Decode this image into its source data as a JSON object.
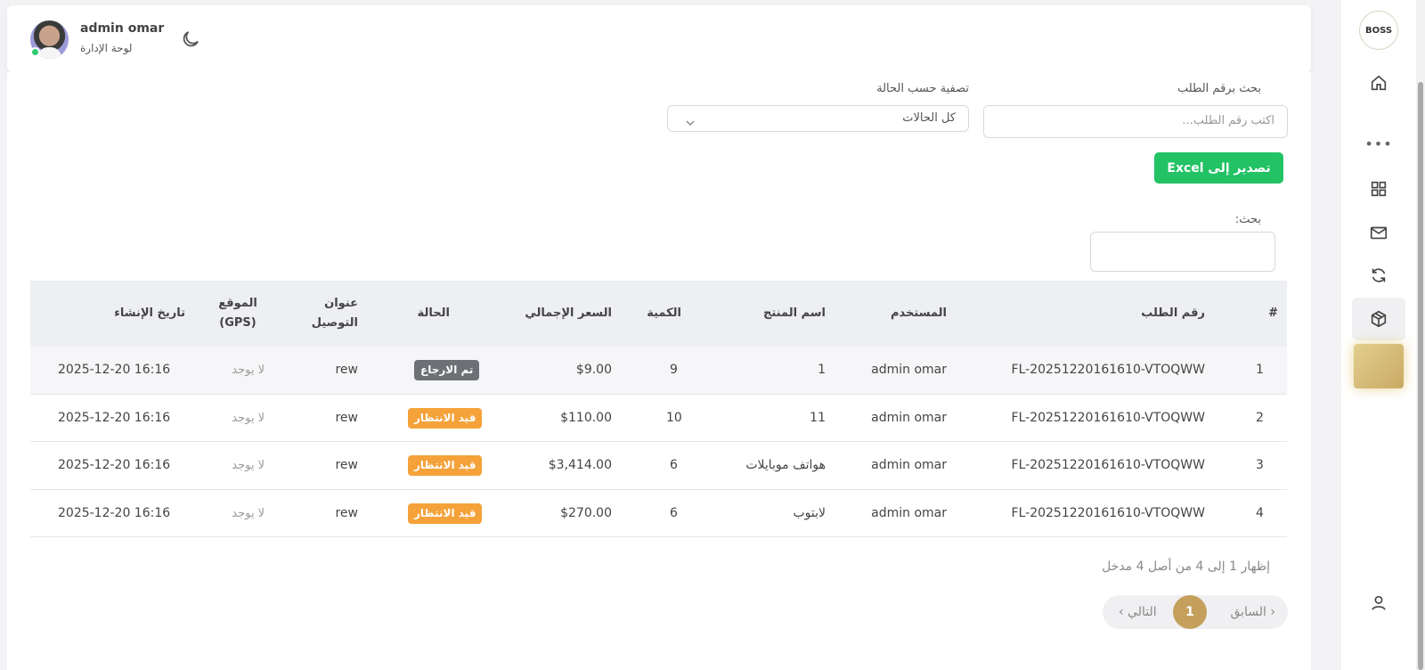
{
  "topbar": {
    "user_name": "admin omar",
    "user_role": "لوحة الإدارة"
  },
  "sidebar": {
    "logo_text": "BOSS",
    "items": [
      "home-icon",
      "more-icon",
      "grid-icon",
      "mail-icon",
      "refresh-icon",
      "box-icon"
    ]
  },
  "filters": {
    "search_label": "بحث برقم الطلب",
    "search_placeholder": "اكتب رقم الطلب...",
    "status_label": "تصفية حسب الحالة",
    "status_selected": "كل الحالات"
  },
  "export_label": "تصدير إلى Excel",
  "table_search_label": "بحث:",
  "table": {
    "headers": [
      "#",
      "رقم الطلب",
      "المستخدم",
      "اسم المنتج",
      "الكمية",
      "السعر الإجمالي",
      "الحالة",
      "عنوان التوصيل",
      "الموقع (GPS)",
      "تاريخ الإنشاء"
    ],
    "rows": [
      {
        "n": "1",
        "order": "FL-20251220161610-VTOQWW",
        "user": "admin omar",
        "product": "1",
        "qty": "9",
        "price": "$9.00",
        "status": "تم الارجاع",
        "status_color": "#6d7075",
        "address": "rew",
        "gps": "لا يوجد",
        "date": "2025-12-20 16:16"
      },
      {
        "n": "2",
        "order": "FL-20251220161610-VTOQWW",
        "user": "admin omar",
        "product": "11",
        "qty": "10",
        "price": "$110.00",
        "status": "قيد الانتظار",
        "status_color": "#f5a23a",
        "address": "rew",
        "gps": "لا يوجد",
        "date": "2025-12-20 16:16"
      },
      {
        "n": "3",
        "order": "FL-20251220161610-VTOQWW",
        "user": "admin omar",
        "product": "هواتف موبايلات",
        "qty": "6",
        "price": "$3,414.00",
        "status": "قيد الانتظار",
        "status_color": "#f5a23a",
        "address": "rew",
        "gps": "لا يوجد",
        "date": "2025-12-20 16:16"
      },
      {
        "n": "4",
        "order": "FL-20251220161610-VTOQWW",
        "user": "admin omar",
        "product": "لابتوب",
        "qty": "6",
        "price": "$270.00",
        "status": "قيد الانتظار",
        "status_color": "#f5a23a",
        "address": "rew",
        "gps": "لا يوجد",
        "date": "2025-12-20 16:16"
      }
    ]
  },
  "info_text": "إظهار 1 إلى 4 من أصل 4 مدخل",
  "pagination": {
    "prev": "‹ السابق",
    "current": "1",
    "next": "التالي ›"
  }
}
